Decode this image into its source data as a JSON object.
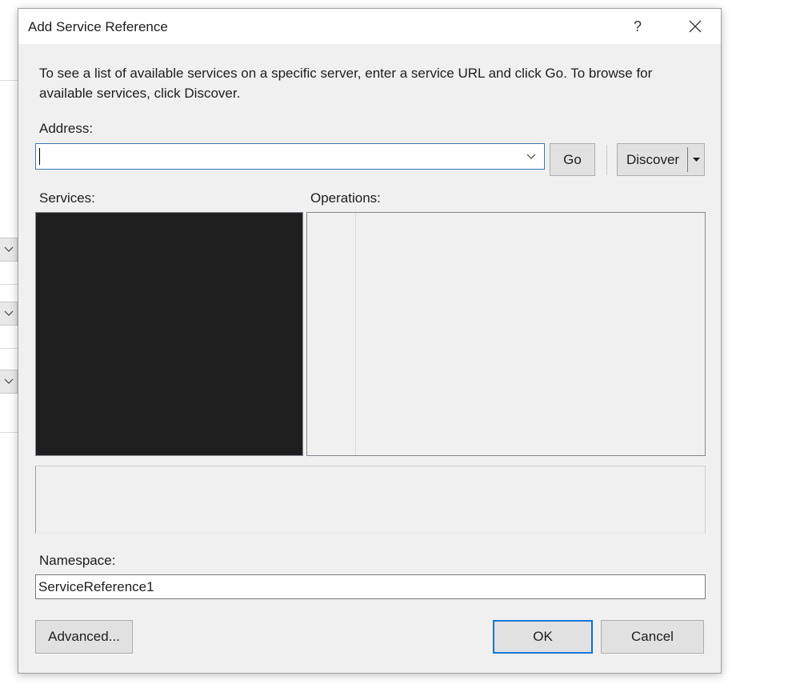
{
  "dialog": {
    "title": "Add Service Reference",
    "help_glyph": "?",
    "close_glyph": "✕"
  },
  "description": "To see a list of available services on a specific server, enter a service URL and click Go. To browse for available services, click Discover.",
  "address": {
    "label": "Address:",
    "value": "",
    "go_label": "Go",
    "discover_label": "Discover"
  },
  "services": {
    "label": "Services:"
  },
  "operations": {
    "label": "Operations:"
  },
  "namespace": {
    "label": "Namespace:",
    "value": "ServiceReference1"
  },
  "buttons": {
    "advanced": "Advanced...",
    "ok": "OK",
    "cancel": "Cancel"
  },
  "colors": {
    "dialog_bg": "#f0f0f0",
    "accent": "#0078d7",
    "services_bg": "#1e1e1e"
  },
  "icons": {
    "combo_arrow": "chevron-down-icon",
    "split_arrow": "caret-down-icon"
  }
}
